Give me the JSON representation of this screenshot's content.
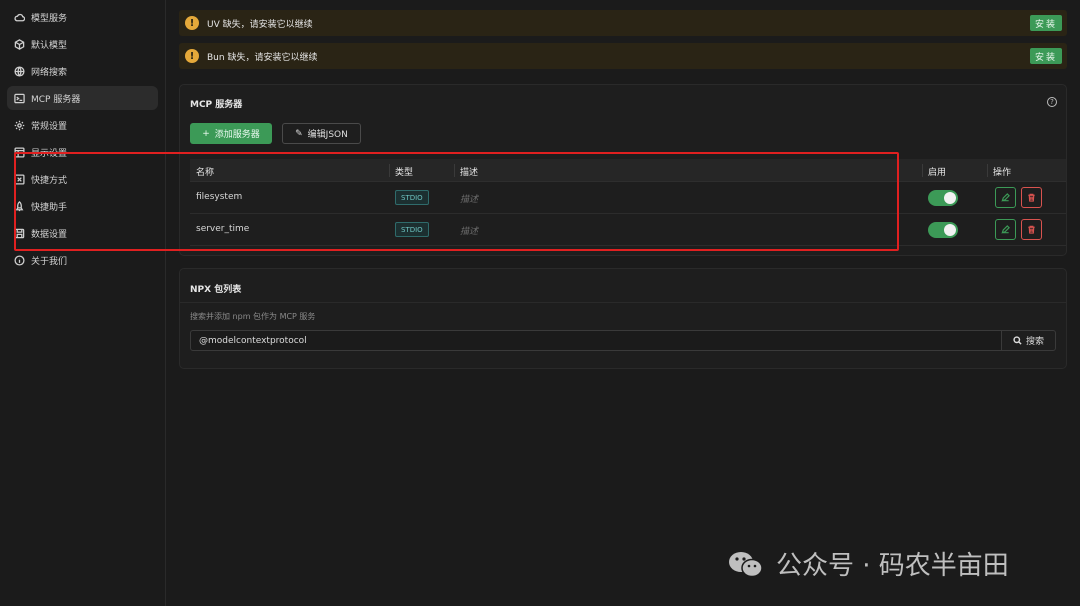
{
  "sidebar": {
    "items": [
      {
        "label": "模型服务",
        "icon": "cloud-icon"
      },
      {
        "label": "默认模型",
        "icon": "cube-icon"
      },
      {
        "label": "网络搜索",
        "icon": "globe-icon"
      },
      {
        "label": "MCP 服务器",
        "icon": "terminal-icon",
        "active": true
      },
      {
        "label": "常规设置",
        "icon": "gear-icon"
      },
      {
        "label": "显示设置",
        "icon": "layout-icon"
      },
      {
        "label": "快捷方式",
        "icon": "command-icon"
      },
      {
        "label": "快捷助手",
        "icon": "rocket-icon"
      },
      {
        "label": "数据设置",
        "icon": "save-icon"
      },
      {
        "label": "关于我们",
        "icon": "info-icon"
      }
    ]
  },
  "alerts": [
    {
      "text": "UV 缺失，请安装它以继续",
      "button": "安装"
    },
    {
      "text": "Bun 缺失，请安装它以继续",
      "button": "安装"
    }
  ],
  "mcp": {
    "title": "MCP 服务器",
    "add_button": "添加服务器",
    "json_button": "编辑JSON",
    "columns": [
      "名称",
      "类型",
      "描述",
      "启用",
      "操作"
    ],
    "rows": [
      {
        "name": "filesystem",
        "type": "STDIO",
        "desc": "描述",
        "enabled": true
      },
      {
        "name": "server_time",
        "type": "STDIO",
        "desc": "描述",
        "enabled": true
      }
    ]
  },
  "npx": {
    "title": "NPX 包列表",
    "subtitle": "搜索并添加 npm 包作为 MCP 服务",
    "search_value": "@modelcontextprotocol",
    "search_button": "搜索"
  },
  "watermark": {
    "text": "公众号 · 码农半亩田"
  },
  "colors": {
    "accent": "#3c9a57",
    "danger": "#d9534f",
    "warning": "#e5a93a",
    "highlight_box": "#e02020"
  }
}
